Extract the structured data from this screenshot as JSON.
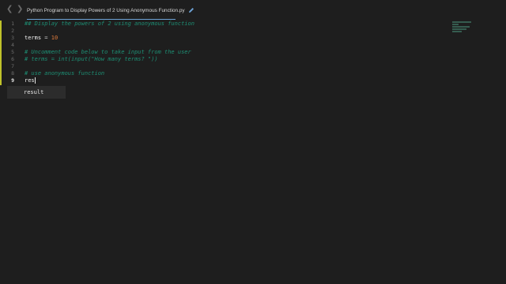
{
  "titlebar": {
    "back_icon": "chevron-left-icon",
    "forward_icon": "chevron-right-icon",
    "tab_title": "Python Program to Display Powers of 2 Using Anonymous Function.py",
    "edit_icon": "pencil-icon"
  },
  "gutter": {
    "line_numbers": [
      "1",
      "2",
      "3",
      "4",
      "5",
      "6",
      "7",
      "8",
      "9"
    ],
    "active_line": "9"
  },
  "code": {
    "line1_comment": "## Display the powers of 2 using anonymous function",
    "line3_var": "terms",
    "line3_op": " = ",
    "line3_num": "10",
    "line5_comment": "# Uncomment code below to take input from the user",
    "line6_comment": "# terms = int(input(\"How many terms? \"))",
    "line8_comment": "# use anonymous function",
    "line9_typed": "res"
  },
  "autocomplete": {
    "items": [
      "result"
    ]
  },
  "colors": {
    "background": "#1e1e1e",
    "comment": "#1d8f74",
    "number": "#e07b3c",
    "gutter_marker": "#bfc22a",
    "tab_underline": "#6ea3d6"
  }
}
